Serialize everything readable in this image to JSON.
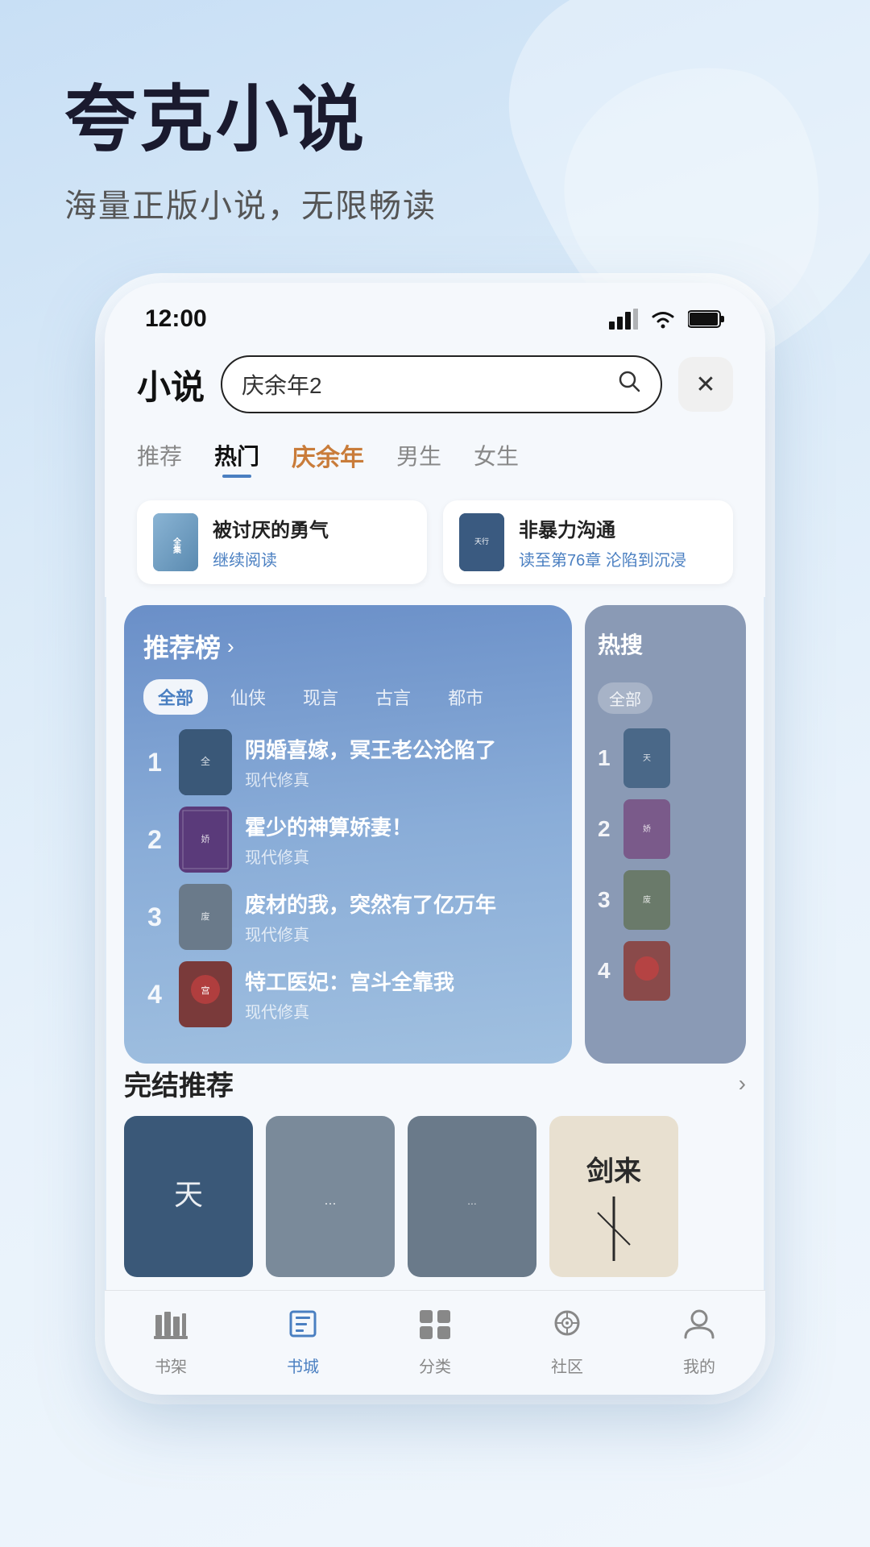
{
  "app": {
    "title": "夸克小说",
    "subtitle": "海量正版小说，无限畅读"
  },
  "statusBar": {
    "time": "12:00"
  },
  "topBar": {
    "pageTitle": "小说",
    "searchPlaceholder": "庆余年2",
    "closeLabel": "×"
  },
  "navTabs": [
    {
      "label": "推荐",
      "active": false,
      "special": false
    },
    {
      "label": "热门",
      "active": true,
      "special": false
    },
    {
      "label": "庆余年",
      "active": false,
      "special": true
    },
    {
      "label": "男生",
      "active": false,
      "special": false
    },
    {
      "label": "女生",
      "active": false,
      "special": false
    }
  ],
  "recentBooks": [
    {
      "title": "被讨厌的勇气",
      "progress": "继续阅读"
    },
    {
      "title": "非暴力沟通",
      "progress": "读至第76章 沦陷到沉浸"
    }
  ],
  "rankingPanel": {
    "title": "推荐榜",
    "arrow": "›",
    "filters": [
      "全部",
      "仙侠",
      "现言",
      "古言",
      "都市"
    ],
    "activeFilter": "全部",
    "items": [
      {
        "rank": 1,
        "title": "阴婚喜嫁，冥王老公沦陷了",
        "tag": "现代修真"
      },
      {
        "rank": 2,
        "title": "霍少的神算娇妻！",
        "tag": "现代修真"
      },
      {
        "rank": 3,
        "title": "废材的我，突然有了亿万年",
        "tag": "现代修真"
      },
      {
        "rank": 4,
        "title": "特工医妃：宫斗全靠我",
        "tag": "现代修真"
      }
    ]
  },
  "hotPanel": {
    "title": "热搜",
    "filterLabel": "全部",
    "items": [
      {
        "rank": 1
      },
      {
        "rank": 2
      },
      {
        "rank": 3
      },
      {
        "rank": 4
      }
    ]
  },
  "completedSection": {
    "title": "完结推荐",
    "arrow": "›",
    "books": [
      {
        "title": "天"
      },
      {
        "title": ""
      },
      {
        "title": ""
      },
      {
        "title": "剑来"
      }
    ]
  },
  "bottomNav": [
    {
      "label": "书架",
      "icon": "bookshelf",
      "active": false
    },
    {
      "label": "书城",
      "icon": "book",
      "active": true
    },
    {
      "label": "分类",
      "icon": "grid",
      "active": false
    },
    {
      "label": "社区",
      "icon": "community",
      "active": false
    },
    {
      "label": "我的",
      "icon": "profile",
      "active": false
    }
  ]
}
